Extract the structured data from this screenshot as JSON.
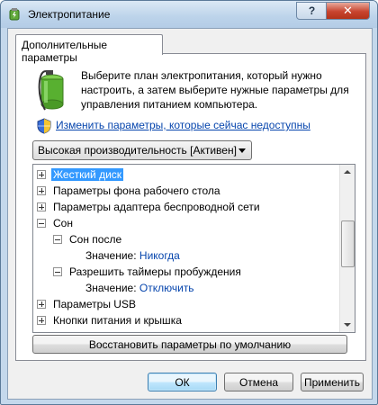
{
  "window": {
    "title": "Электропитание",
    "help_label": "?",
    "close_label": "✕"
  },
  "tab": {
    "label": "Дополнительные параметры"
  },
  "description": "Выберите план электропитания, который нужно настроить, а затем выберите нужные параметры для управления питанием компьютера.",
  "change_link": "Изменить параметры, которые сейчас недоступны",
  "plan_dropdown": {
    "selected": "Высокая производительность [Активен]"
  },
  "tree": {
    "items": [
      {
        "label": "Жесткий диск",
        "expander": "plus",
        "level": 0,
        "selected": true
      },
      {
        "label": "Параметры фона рабочего стола",
        "expander": "plus",
        "level": 0
      },
      {
        "label": "Параметры адаптера беспроводной сети",
        "expander": "plus",
        "level": 0
      },
      {
        "label": "Сон",
        "expander": "minus",
        "level": 0
      },
      {
        "label": "Сон после",
        "expander": "minus",
        "level": 1
      },
      {
        "label": "Значение:",
        "value": "Никогда",
        "level": 2
      },
      {
        "label": "Разрешить таймеры пробуждения",
        "expander": "minus",
        "level": 1
      },
      {
        "label": "Значение:",
        "value": "Отключить",
        "level": 2
      },
      {
        "label": "Параметры USB",
        "expander": "plus",
        "level": 0
      },
      {
        "label": "Кнопки питания и крышка",
        "expander": "plus",
        "level": 0
      }
    ]
  },
  "buttons": {
    "restore": "Восстановить параметры по умолчанию",
    "ok": "ОК",
    "cancel": "Отмена",
    "apply": "Применить"
  }
}
